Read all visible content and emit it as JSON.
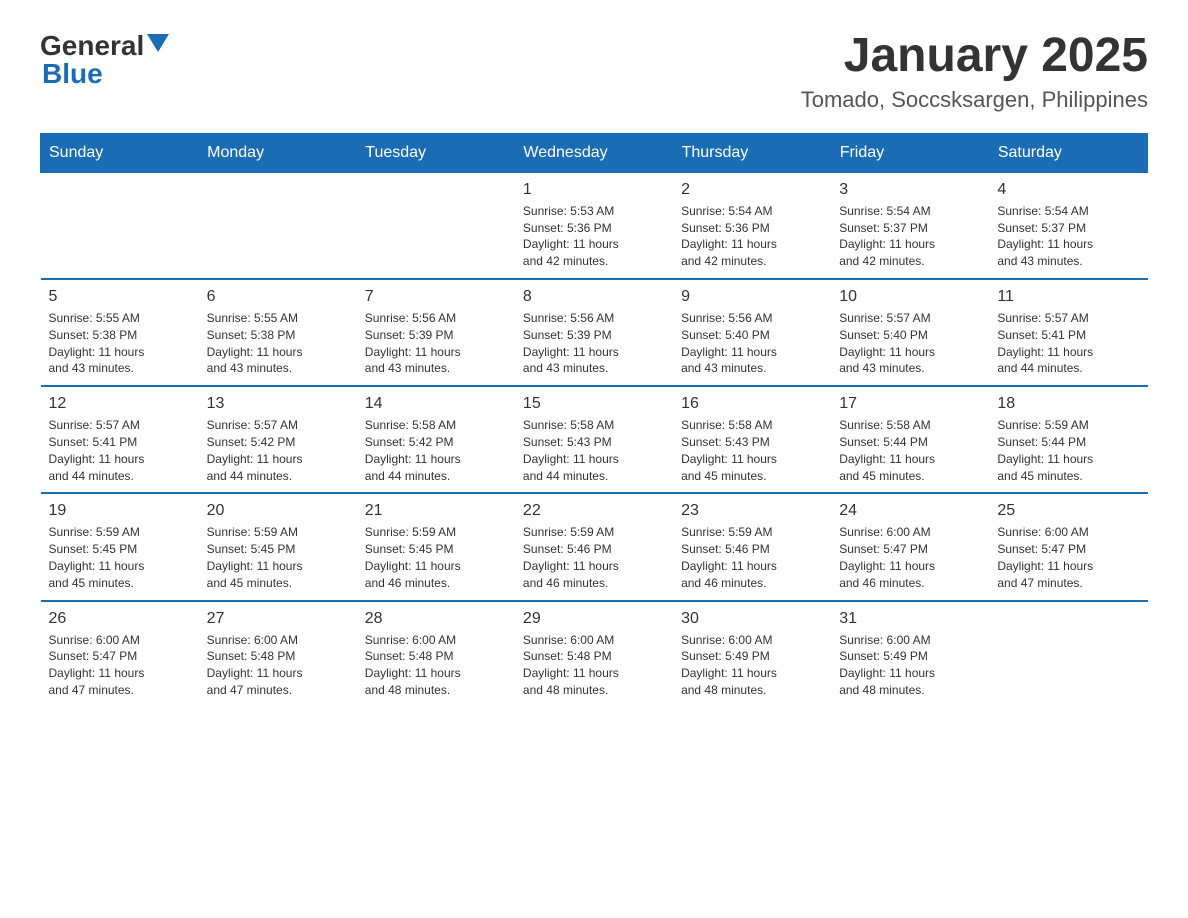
{
  "header": {
    "logo_general": "General",
    "logo_blue": "Blue",
    "title": "January 2025",
    "subtitle": "Tomado, Soccsksargen, Philippines"
  },
  "calendar": {
    "days_of_week": [
      "Sunday",
      "Monday",
      "Tuesday",
      "Wednesday",
      "Thursday",
      "Friday",
      "Saturday"
    ],
    "weeks": [
      [
        {
          "day": "",
          "info": ""
        },
        {
          "day": "",
          "info": ""
        },
        {
          "day": "",
          "info": ""
        },
        {
          "day": "1",
          "info": "Sunrise: 5:53 AM\nSunset: 5:36 PM\nDaylight: 11 hours\nand 42 minutes."
        },
        {
          "day": "2",
          "info": "Sunrise: 5:54 AM\nSunset: 5:36 PM\nDaylight: 11 hours\nand 42 minutes."
        },
        {
          "day": "3",
          "info": "Sunrise: 5:54 AM\nSunset: 5:37 PM\nDaylight: 11 hours\nand 42 minutes."
        },
        {
          "day": "4",
          "info": "Sunrise: 5:54 AM\nSunset: 5:37 PM\nDaylight: 11 hours\nand 43 minutes."
        }
      ],
      [
        {
          "day": "5",
          "info": "Sunrise: 5:55 AM\nSunset: 5:38 PM\nDaylight: 11 hours\nand 43 minutes."
        },
        {
          "day": "6",
          "info": "Sunrise: 5:55 AM\nSunset: 5:38 PM\nDaylight: 11 hours\nand 43 minutes."
        },
        {
          "day": "7",
          "info": "Sunrise: 5:56 AM\nSunset: 5:39 PM\nDaylight: 11 hours\nand 43 minutes."
        },
        {
          "day": "8",
          "info": "Sunrise: 5:56 AM\nSunset: 5:39 PM\nDaylight: 11 hours\nand 43 minutes."
        },
        {
          "day": "9",
          "info": "Sunrise: 5:56 AM\nSunset: 5:40 PM\nDaylight: 11 hours\nand 43 minutes."
        },
        {
          "day": "10",
          "info": "Sunrise: 5:57 AM\nSunset: 5:40 PM\nDaylight: 11 hours\nand 43 minutes."
        },
        {
          "day": "11",
          "info": "Sunrise: 5:57 AM\nSunset: 5:41 PM\nDaylight: 11 hours\nand 44 minutes."
        }
      ],
      [
        {
          "day": "12",
          "info": "Sunrise: 5:57 AM\nSunset: 5:41 PM\nDaylight: 11 hours\nand 44 minutes."
        },
        {
          "day": "13",
          "info": "Sunrise: 5:57 AM\nSunset: 5:42 PM\nDaylight: 11 hours\nand 44 minutes."
        },
        {
          "day": "14",
          "info": "Sunrise: 5:58 AM\nSunset: 5:42 PM\nDaylight: 11 hours\nand 44 minutes."
        },
        {
          "day": "15",
          "info": "Sunrise: 5:58 AM\nSunset: 5:43 PM\nDaylight: 11 hours\nand 44 minutes."
        },
        {
          "day": "16",
          "info": "Sunrise: 5:58 AM\nSunset: 5:43 PM\nDaylight: 11 hours\nand 45 minutes."
        },
        {
          "day": "17",
          "info": "Sunrise: 5:58 AM\nSunset: 5:44 PM\nDaylight: 11 hours\nand 45 minutes."
        },
        {
          "day": "18",
          "info": "Sunrise: 5:59 AM\nSunset: 5:44 PM\nDaylight: 11 hours\nand 45 minutes."
        }
      ],
      [
        {
          "day": "19",
          "info": "Sunrise: 5:59 AM\nSunset: 5:45 PM\nDaylight: 11 hours\nand 45 minutes."
        },
        {
          "day": "20",
          "info": "Sunrise: 5:59 AM\nSunset: 5:45 PM\nDaylight: 11 hours\nand 45 minutes."
        },
        {
          "day": "21",
          "info": "Sunrise: 5:59 AM\nSunset: 5:45 PM\nDaylight: 11 hours\nand 46 minutes."
        },
        {
          "day": "22",
          "info": "Sunrise: 5:59 AM\nSunset: 5:46 PM\nDaylight: 11 hours\nand 46 minutes."
        },
        {
          "day": "23",
          "info": "Sunrise: 5:59 AM\nSunset: 5:46 PM\nDaylight: 11 hours\nand 46 minutes."
        },
        {
          "day": "24",
          "info": "Sunrise: 6:00 AM\nSunset: 5:47 PM\nDaylight: 11 hours\nand 46 minutes."
        },
        {
          "day": "25",
          "info": "Sunrise: 6:00 AM\nSunset: 5:47 PM\nDaylight: 11 hours\nand 47 minutes."
        }
      ],
      [
        {
          "day": "26",
          "info": "Sunrise: 6:00 AM\nSunset: 5:47 PM\nDaylight: 11 hours\nand 47 minutes."
        },
        {
          "day": "27",
          "info": "Sunrise: 6:00 AM\nSunset: 5:48 PM\nDaylight: 11 hours\nand 47 minutes."
        },
        {
          "day": "28",
          "info": "Sunrise: 6:00 AM\nSunset: 5:48 PM\nDaylight: 11 hours\nand 48 minutes."
        },
        {
          "day": "29",
          "info": "Sunrise: 6:00 AM\nSunset: 5:48 PM\nDaylight: 11 hours\nand 48 minutes."
        },
        {
          "day": "30",
          "info": "Sunrise: 6:00 AM\nSunset: 5:49 PM\nDaylight: 11 hours\nand 48 minutes."
        },
        {
          "day": "31",
          "info": "Sunrise: 6:00 AM\nSunset: 5:49 PM\nDaylight: 11 hours\nand 48 minutes."
        },
        {
          "day": "",
          "info": ""
        }
      ]
    ]
  }
}
